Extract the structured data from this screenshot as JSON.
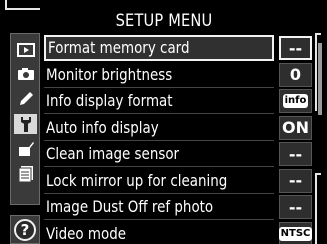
{
  "title": "SETUP MENU",
  "tabs": [
    {
      "icon": "playback-icon",
      "active": false
    },
    {
      "icon": "camera-icon",
      "active": false
    },
    {
      "icon": "pencil-icon",
      "active": false
    },
    {
      "icon": "wrench-icon",
      "active": true
    },
    {
      "icon": "retouch-icon",
      "active": false
    },
    {
      "icon": "recent-settings-icon",
      "active": false
    }
  ],
  "help": {
    "icon": "help-icon",
    "label": "?"
  },
  "items": [
    {
      "label": "Format memory card",
      "value": "--",
      "selected": true
    },
    {
      "label": "Monitor brightness",
      "value": "0"
    },
    {
      "label": "Info display format",
      "value": "info",
      "badge": true
    },
    {
      "label": "Auto info display",
      "value": "ON"
    },
    {
      "label": "Clean image sensor",
      "value": "--"
    },
    {
      "label": "Lock mirror up for cleaning",
      "value": "--"
    },
    {
      "label": "Image Dust Off ref photo",
      "value": "--"
    },
    {
      "label": "Video mode",
      "value": "NTSC",
      "badge": true
    }
  ],
  "colors": {
    "background": "#000000",
    "selection_border": "#f2f2f2",
    "active_tab": "#d9d9d9"
  }
}
